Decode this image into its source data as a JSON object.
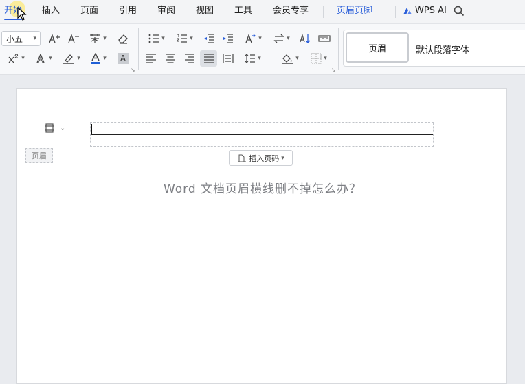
{
  "tabs": {
    "items": [
      {
        "label": "开始"
      },
      {
        "label": "插入"
      },
      {
        "label": "页面"
      },
      {
        "label": "引用"
      },
      {
        "label": "审阅"
      },
      {
        "label": "视图"
      },
      {
        "label": "工具"
      },
      {
        "label": "会员专享"
      },
      {
        "label": "页眉页脚"
      }
    ],
    "active": "开始",
    "wps_ai": "WPS AI"
  },
  "toolbar": {
    "font_size": "小五",
    "font_color": "#1f5fd6"
  },
  "styles": {
    "current": "页眉",
    "default_label": "默认段落字体"
  },
  "document": {
    "header_tag": "页眉",
    "insert_page_number": "插入页码",
    "overlay_title": "Word 文档页眉横线删不掉怎么办？"
  },
  "colors": {
    "accent": "#2b5fd9",
    "font_color_bar": "#1f5fd6"
  }
}
